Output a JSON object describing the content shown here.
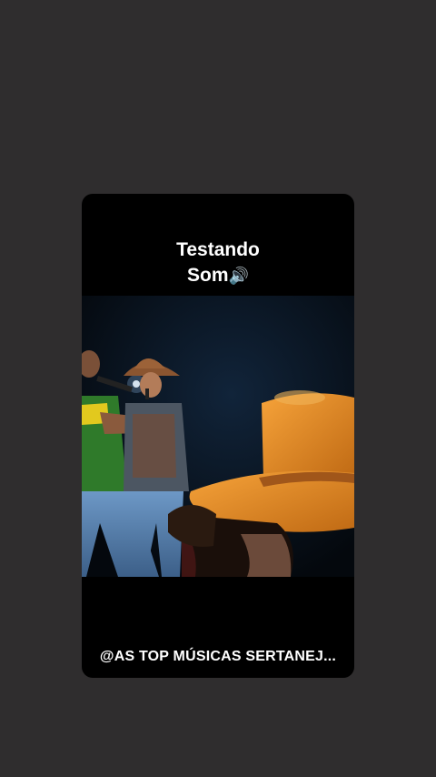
{
  "story": {
    "caption_line1": "Testando",
    "caption_line2": "Som",
    "caption_icon": "speaker-volume-icon",
    "caption_glyph": "🔊",
    "video_description_icon": "concert-video-frame",
    "watermark": "@AS TOP MÚSICAS SERTANEJ..."
  },
  "colors": {
    "background": "#2f2d2e",
    "card": "#000000",
    "hat_orange": "#e4932a",
    "stage_blue": "#0b1a2a"
  }
}
